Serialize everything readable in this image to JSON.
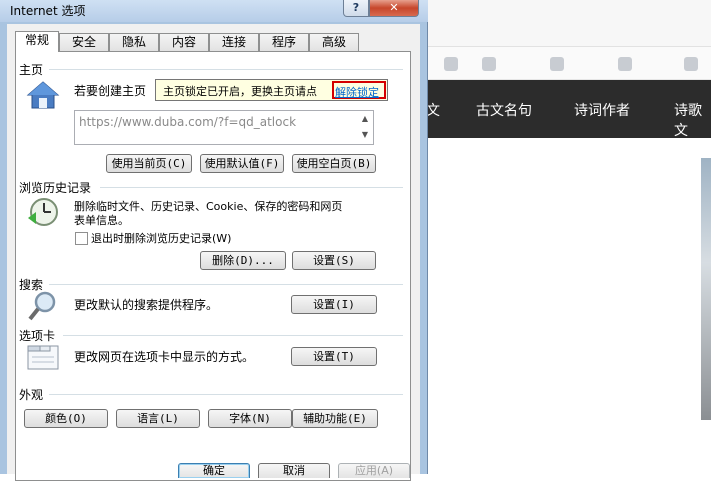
{
  "background": {
    "nav_items": [
      "文",
      "古文名句",
      "诗词作者",
      "诗歌文"
    ]
  },
  "dialog": {
    "title": "Internet 选项",
    "help_label": "?",
    "close_label": "✕",
    "tabs": [
      {
        "label": "常规"
      },
      {
        "label": "安全"
      },
      {
        "label": "隐私"
      },
      {
        "label": "内容"
      },
      {
        "label": "连接"
      },
      {
        "label": "程序"
      },
      {
        "label": "高级"
      }
    ],
    "home": {
      "title": "主页",
      "desc": "若要创建主页",
      "url": "https://www.duba.com/?f=qd_atlock",
      "tooltip_text": "主页锁定已开启，更换主页请点",
      "tooltip_link": "解除锁定",
      "btn_current": "使用当前页(C)",
      "btn_default": "使用默认值(F)",
      "btn_blank": "使用空白页(B)"
    },
    "history": {
      "title": "浏览历史记录",
      "desc_line1": "删除临时文件、历史记录、Cookie、保存的密码和网页",
      "desc_line2": "表单信息。",
      "checkbox_label": "退出时删除浏览历史记录(W)",
      "btn_delete": "删除(D)...",
      "btn_settings": "设置(S)"
    },
    "search": {
      "title": "搜索",
      "desc": "更改默认的搜索提供程序。",
      "btn_settings": "设置(I)"
    },
    "tabs_group": {
      "title": "选项卡",
      "desc": "更改网页在选项卡中显示的方式。",
      "btn_settings": "设置(T)"
    },
    "appearance": {
      "title": "外观",
      "btn_colors": "颜色(O)",
      "btn_languages": "语言(L)",
      "btn_fonts": "字体(N)",
      "btn_accessibility": "辅助功能(E)"
    },
    "footer": {
      "ok": "确定",
      "cancel": "取消",
      "apply": "应用(A)"
    }
  }
}
